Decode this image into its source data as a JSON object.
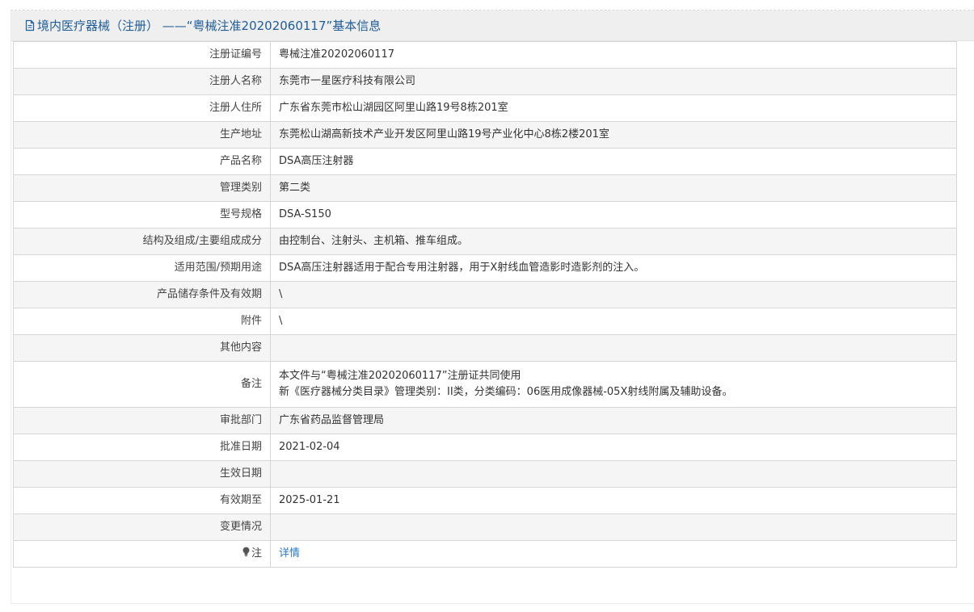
{
  "header": {
    "title": "境内医疗器械（注册） ——“粤械注准20202060117”基本信息",
    "icon": "document-icon",
    "color": "#1f5c99"
  },
  "rows": [
    {
      "label": "注册证编号",
      "value": "粤械注准20202060117"
    },
    {
      "label": "注册人名称",
      "value": "东莞市一星医疗科技有限公司"
    },
    {
      "label": "注册人住所",
      "value": "广东省东莞市松山湖园区阿里山路19号8栋201室"
    },
    {
      "label": "生产地址",
      "value": "东莞松山湖高新技术产业开发区阿里山路19号产业化中心8栋2楼201室"
    },
    {
      "label": "产品名称",
      "value": "DSA高压注射器"
    },
    {
      "label": "管理类别",
      "value": "第二类"
    },
    {
      "label": "型号规格",
      "value": "DSA-S150"
    },
    {
      "label": "结构及组成/主要组成成分",
      "value": "由控制台、注射头、主机箱、推车组成。"
    },
    {
      "label": "适用范围/预期用途",
      "value": "DSA高压注射器适用于配合专用注射器，用于X射线血管造影时造影剂的注入。"
    },
    {
      "label": "产品储存条件及有效期",
      "value": "\\"
    },
    {
      "label": "附件",
      "value": "\\"
    },
    {
      "label": "其他内容",
      "value": ""
    },
    {
      "label": "备注",
      "value_line1": "本文件与“粤械注准20202060117”注册证共同使用",
      "value_line2": "新《医疗器械分类目录》管理类别：II类，分类编码：06医用成像器械-05X射线附属及辅助设备。"
    },
    {
      "label": "审批部门",
      "value": "广东省药品监督管理局"
    },
    {
      "label": "批准日期",
      "value": "2021-02-04"
    },
    {
      "label": "生效日期",
      "value": ""
    },
    {
      "label": "有效期至",
      "value": "2025-01-21"
    },
    {
      "label": "变更情况",
      "value": ""
    },
    {
      "label": "注",
      "icon": "lightbulb-icon",
      "link_text": "详情",
      "link_color": "#2a78c2"
    }
  ]
}
